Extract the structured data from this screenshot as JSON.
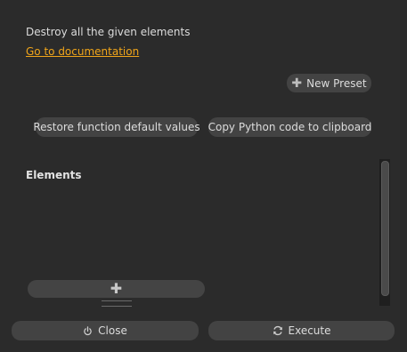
{
  "description": "Destroy all the given elements",
  "doc_link": "Go to documentation",
  "presets": {
    "new_preset_label": "New Preset",
    "new_preset_icon": "plus-icon"
  },
  "actions": {
    "restore_label": "Restore function default values",
    "copy_python_label": "Copy Python code to clipboard"
  },
  "elements": {
    "label": "Elements",
    "items": [],
    "add_icon": "plus-icon"
  },
  "footer": {
    "close_label": "Close",
    "close_icon": "power-icon",
    "execute_label": "Execute",
    "execute_icon": "refresh-icon"
  },
  "colors": {
    "background": "#2b2b2b",
    "button": "#434343",
    "link": "#f0a51a",
    "text": "#dcdcdc"
  }
}
